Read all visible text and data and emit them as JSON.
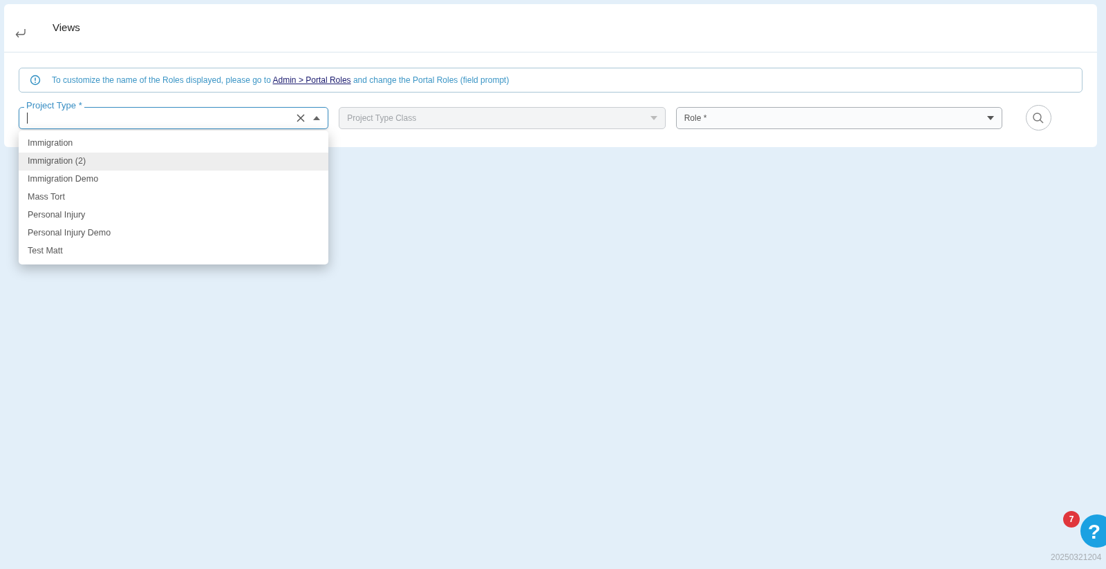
{
  "header": {
    "title": "Views"
  },
  "info": {
    "before": "To customize the name of the Roles displayed, please go to",
    "link": "Admin > Portal Roles",
    "after": "and change the Portal Roles (field prompt)"
  },
  "fields": [
    {
      "label": "Project Type *",
      "kind": "open"
    },
    {
      "label": "Project Type Class",
      "kind": "closed",
      "disabled": true
    },
    {
      "label": "Role *",
      "kind": "closed",
      "disabled": false
    }
  ],
  "options": [
    {
      "label": "Immigration",
      "selected": false
    },
    {
      "label": "Immigration (2)",
      "selected": true
    },
    {
      "label": "Immigration Demo",
      "selected": false
    },
    {
      "label": "Mass Tort",
      "selected": false
    },
    {
      "label": "Personal Injury",
      "selected": false
    },
    {
      "label": "Personal Injury Demo",
      "selected": false
    },
    {
      "label": "Test Matt",
      "selected": false
    }
  ],
  "help": {
    "glyph": "?",
    "badge": "7"
  },
  "version": "20250321204"
}
